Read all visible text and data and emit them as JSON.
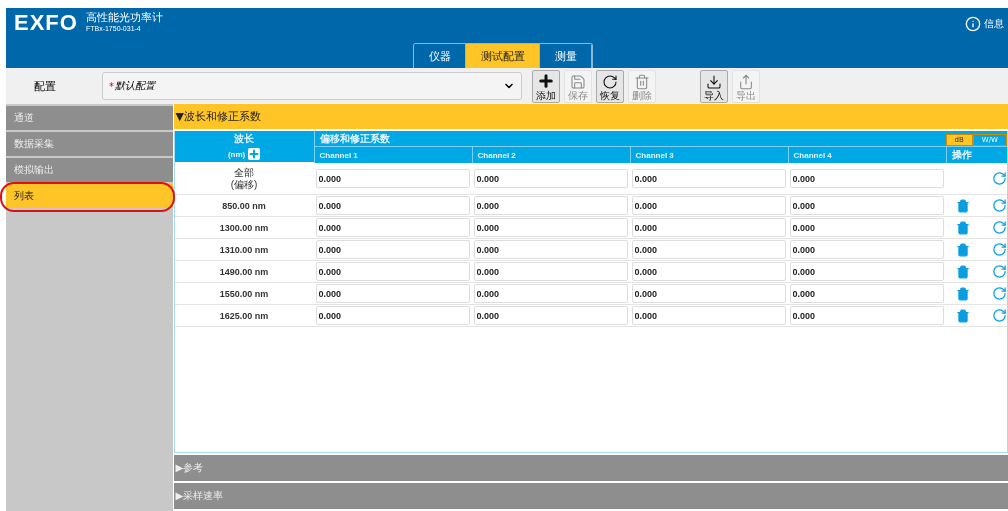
{
  "header": {
    "logo": "EXFO",
    "title": "高性能光功率计",
    "model": "FTBx-1750-031-4",
    "info": "信息"
  },
  "tabs": [
    {
      "label": "仪器",
      "selected": false
    },
    {
      "label": "测试配置",
      "selected": true
    },
    {
      "label": "测量",
      "selected": false
    }
  ],
  "config": {
    "label": "配置",
    "required_mark": "*",
    "value": "默认配置"
  },
  "toolbar": [
    {
      "kind": "add",
      "label": "添加",
      "disabled": false
    },
    {
      "kind": "save",
      "label": "保存",
      "disabled": true
    },
    {
      "kind": "restore",
      "label": "恢复",
      "disabled": false
    },
    {
      "kind": "delete",
      "label": "删除",
      "disabled": true
    },
    {
      "kind": "import",
      "label": "导入",
      "disabled": false
    },
    {
      "kind": "export",
      "label": "导出",
      "disabled": true
    }
  ],
  "sidebar": {
    "items": [
      {
        "label": "通道",
        "selected": false,
        "annotated": false
      },
      {
        "label": "数据采集",
        "selected": false,
        "annotated": false
      },
      {
        "label": "模拟输出",
        "selected": false,
        "annotated": false
      },
      {
        "label": "列表",
        "selected": true,
        "annotated": true
      }
    ]
  },
  "section": {
    "title": "▼波长和修正系数",
    "expanded": true
  },
  "table": {
    "wavelength_header": "波长",
    "unit_header": "(nm)",
    "group_header": "偏移和修正系数",
    "units": [
      {
        "label": "dB",
        "selected": true
      },
      {
        "label": "W/W",
        "selected": false
      }
    ],
    "columns": [
      "Channel 1",
      "Channel 2",
      "Channel 3",
      "Channel 4"
    ],
    "actions_header": "操作",
    "rows": [
      {
        "wavelength": "全部",
        "sub": "(偏移)",
        "values": [
          "0.000",
          "0.000",
          "0.000",
          "0.000"
        ],
        "deletable": false
      },
      {
        "wavelength": "850.00 nm",
        "values": [
          "0.000",
          "0.000",
          "0.000",
          "0.000"
        ],
        "deletable": true
      },
      {
        "wavelength": "1300.00 nm",
        "values": [
          "0.000",
          "0.000",
          "0.000",
          "0.000"
        ],
        "deletable": true
      },
      {
        "wavelength": "1310.00 nm",
        "values": [
          "0.000",
          "0.000",
          "0.000",
          "0.000"
        ],
        "deletable": true
      },
      {
        "wavelength": "1490.00 nm",
        "values": [
          "0.000",
          "0.000",
          "0.000",
          "0.000"
        ],
        "deletable": true
      },
      {
        "wavelength": "1550.00 nm",
        "values": [
          "0.000",
          "0.000",
          "0.000",
          "0.000"
        ],
        "deletable": true
      },
      {
        "wavelength": "1625.00 nm",
        "values": [
          "0.000",
          "0.000",
          "0.000",
          "0.000"
        ],
        "deletable": true
      }
    ]
  },
  "collapsed_sections": [
    {
      "title": "▶参考"
    },
    {
      "title": "▶采样速率"
    }
  ]
}
